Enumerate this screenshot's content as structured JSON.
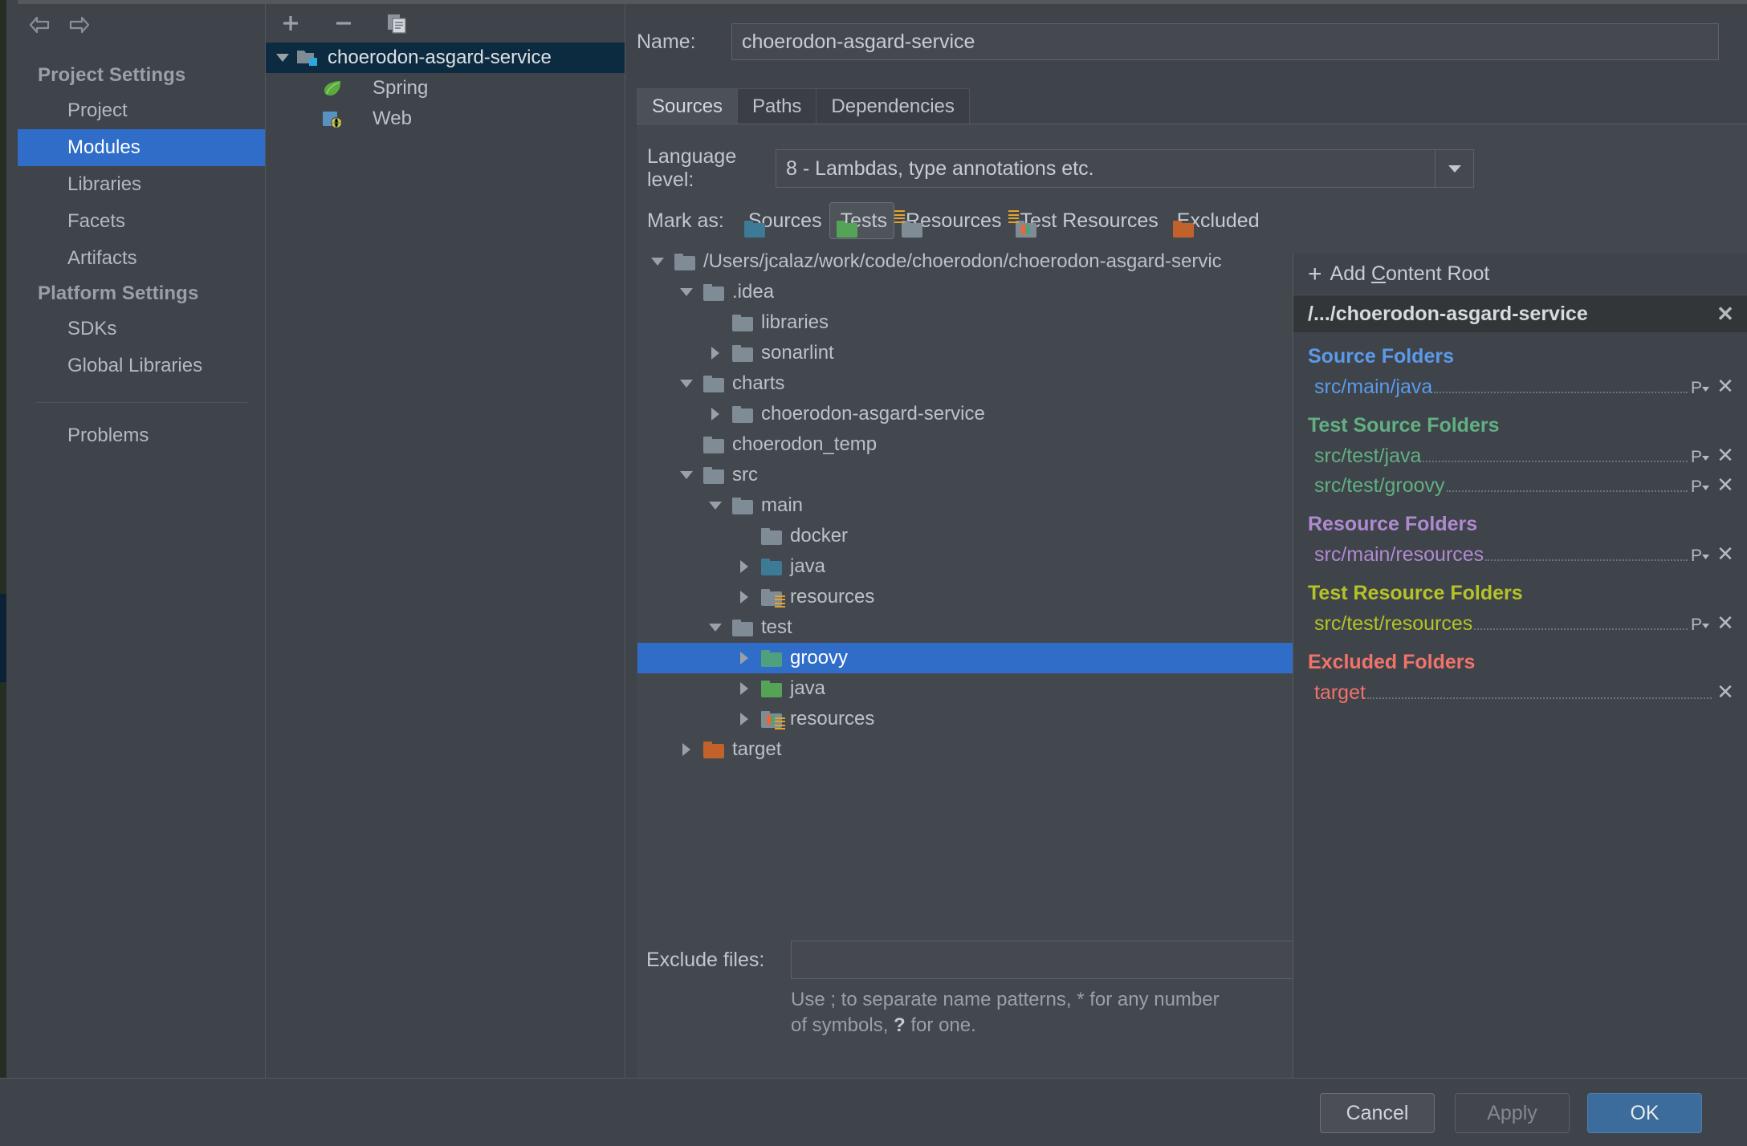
{
  "sidebar": {
    "nav": {
      "back_icon": "arrow-left-icon",
      "forward_icon": "arrow-right-icon"
    },
    "groups": [
      {
        "label": "Project Settings",
        "items": [
          {
            "label": "Project",
            "selected": false
          },
          {
            "label": "Modules",
            "selected": true
          },
          {
            "label": "Libraries",
            "selected": false
          },
          {
            "label": "Facets",
            "selected": false
          },
          {
            "label": "Artifacts",
            "selected": false
          }
        ]
      },
      {
        "label": "Platform Settings",
        "items": [
          {
            "label": "SDKs",
            "selected": false
          },
          {
            "label": "Global Libraries",
            "selected": false
          }
        ]
      }
    ],
    "problems_label": "Problems",
    "help_label": "?"
  },
  "modules": {
    "toolbar": {
      "add_label": "+",
      "remove_label": "−",
      "copy_label": "copy-icon"
    },
    "tree": [
      {
        "label": "choerodon-asgard-service",
        "depth": 0,
        "twisty": "down",
        "icon": "module-folder-icon",
        "selected": true
      },
      {
        "label": "Spring",
        "depth": 1,
        "twisty": "none",
        "icon": "spring-leaf-icon",
        "selected": false
      },
      {
        "label": "Web",
        "depth": 1,
        "twisty": "none",
        "icon": "web-facet-icon",
        "selected": false
      }
    ]
  },
  "detail": {
    "name_label": "Name:",
    "name_value": "choerodon-asgard-service",
    "tabs": [
      {
        "label": "Sources",
        "active": true
      },
      {
        "label": "Paths",
        "active": false
      },
      {
        "label": "Dependencies",
        "active": false
      }
    ],
    "language_level": {
      "label": "Language level:",
      "value": "8 - Lambdas, type annotations etc.",
      "arrow_icon": "chevron-down-icon"
    },
    "mark_as": {
      "label": "Mark as:",
      "buttons": [
        {
          "label": "Sources",
          "mnemonic": "S",
          "kind": "sources",
          "pressed": false
        },
        {
          "label": "Tests",
          "mnemonic": "T",
          "kind": "tests",
          "pressed": true
        },
        {
          "label": "Resources",
          "mnemonic": "",
          "kind": "resources",
          "pressed": false
        },
        {
          "label": "Test Resources",
          "mnemonic": "",
          "kind": "testres",
          "pressed": false
        },
        {
          "label": "Excluded",
          "mnemonic": "E",
          "kind": "excluded",
          "pressed": false
        }
      ]
    },
    "content_tree": [
      {
        "label": "/Users/jcalaz/work/code/choerodon/choerodon-asgard-servic",
        "depth": 0,
        "twisty": "down",
        "kind": "plain",
        "selected": false
      },
      {
        "label": ".idea",
        "depth": 1,
        "twisty": "down",
        "kind": "plain",
        "selected": false
      },
      {
        "label": "libraries",
        "depth": 2,
        "twisty": "none",
        "kind": "plain",
        "selected": false
      },
      {
        "label": "sonarlint",
        "depth": 2,
        "twisty": "right",
        "kind": "plain",
        "selected": false
      },
      {
        "label": "charts",
        "depth": 1,
        "twisty": "down",
        "kind": "plain",
        "selected": false
      },
      {
        "label": "choerodon-asgard-service",
        "depth": 2,
        "twisty": "right",
        "kind": "plain",
        "selected": false
      },
      {
        "label": "choerodon_temp",
        "depth": 1,
        "twisty": "none",
        "kind": "plain",
        "selected": false
      },
      {
        "label": "src",
        "depth": 1,
        "twisty": "down",
        "kind": "plain",
        "selected": false
      },
      {
        "label": "main",
        "depth": 2,
        "twisty": "down",
        "kind": "plain",
        "selected": false
      },
      {
        "label": "docker",
        "depth": 3,
        "twisty": "none",
        "kind": "plain",
        "selected": false
      },
      {
        "label": "java",
        "depth": 3,
        "twisty": "right",
        "kind": "sources",
        "selected": false
      },
      {
        "label": "resources",
        "depth": 3,
        "twisty": "right",
        "kind": "resources",
        "selected": false
      },
      {
        "label": "test",
        "depth": 2,
        "twisty": "down",
        "kind": "plain",
        "selected": false
      },
      {
        "label": "groovy",
        "depth": 3,
        "twisty": "right",
        "kind": "groovy",
        "selected": true
      },
      {
        "label": "java",
        "depth": 3,
        "twisty": "right",
        "kind": "tests",
        "selected": false
      },
      {
        "label": "resources",
        "depth": 3,
        "twisty": "right",
        "kind": "testres",
        "selected": false
      },
      {
        "label": "target",
        "depth": 1,
        "twisty": "right",
        "kind": "excluded",
        "selected": false
      }
    ],
    "exclude_files": {
      "label": "Exclude files:",
      "value": "",
      "placeholder": "",
      "hint_1": "Use ; to separate name patterns, * for any number",
      "hint_2_pre": "of symbols, ",
      "hint_2_q": "?",
      "hint_2_post": " for one."
    }
  },
  "rootlist": {
    "add_content_root": {
      "label_pre": "Add ",
      "mnemonic": "C",
      "label_post": "ontent Root",
      "plus": "+"
    },
    "root_header": {
      "label": "/.../choerodon-asgard-service",
      "close_icon": "close-icon"
    },
    "groups": [
      {
        "title": "Source Folders",
        "color_class": "c-source",
        "items": [
          {
            "path": "src/main/java",
            "has_package_prefix": true
          }
        ]
      },
      {
        "title": "Test Source Folders",
        "color_class": "c-test",
        "items": [
          {
            "path": "src/test/java",
            "has_package_prefix": true
          },
          {
            "path": "src/test/groovy",
            "has_package_prefix": true
          }
        ]
      },
      {
        "title": "Resource Folders",
        "color_class": "c-res",
        "items": [
          {
            "path": "src/main/resources",
            "has_package_prefix": true
          }
        ]
      },
      {
        "title": "Test Resource Folders",
        "color_class": "c-testres",
        "items": [
          {
            "path": "src/test/resources",
            "has_package_prefix": true
          }
        ]
      },
      {
        "title": "Excluded Folders",
        "color_class": "c-excl",
        "items": [
          {
            "path": "target",
            "has_package_prefix": false
          }
        ]
      }
    ]
  },
  "footer": {
    "cancel_label": "Cancel",
    "apply_label": "Apply",
    "ok_label": "OK"
  },
  "colors": {
    "selection_blue": "#2f6dc9",
    "ok_blue": "#3c6c9c",
    "source_blue": "#5b9ae8",
    "test_green": "#61b083",
    "resource_purple": "#b08ad0",
    "test_resource_olive": "#b5c327",
    "excluded_red": "#f0736a"
  }
}
